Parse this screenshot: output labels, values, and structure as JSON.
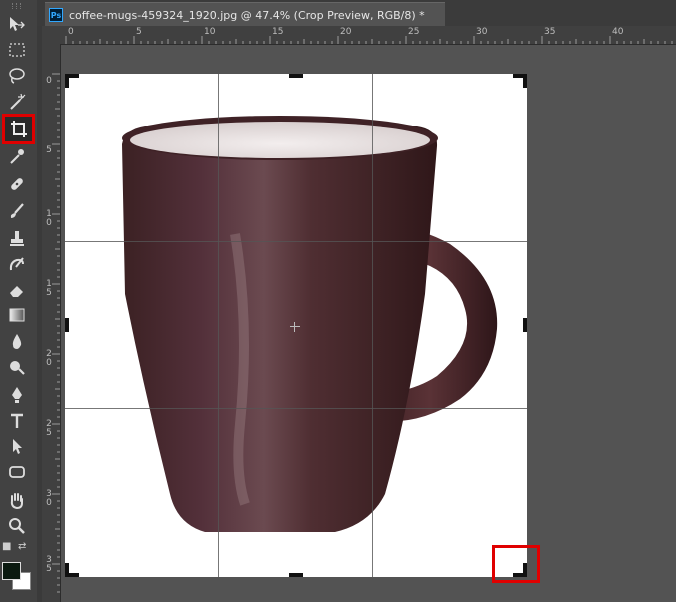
{
  "document_tab": {
    "app_icon": "Ps",
    "title": "coffee-mugs-459324_1920.jpg @ 47.4% (Crop Preview, RGB/8) *"
  },
  "rulers": {
    "top_labels": [
      "0",
      "5",
      "10",
      "15",
      "20",
      "25",
      "30",
      "35",
      "40"
    ],
    "left_labels": [
      "0",
      "5",
      "1 0",
      "1 5",
      "2 0",
      "2 5",
      "3 0",
      "3 5"
    ]
  },
  "tools": [
    {
      "name": "move-tool-icon"
    },
    {
      "name": "rectangular-marquee-tool-icon"
    },
    {
      "name": "lasso-tool-icon"
    },
    {
      "name": "magic-wand-tool-icon"
    },
    {
      "name": "crop-tool-icon",
      "active": true
    },
    {
      "name": "eyedropper-tool-icon"
    },
    {
      "name": "healing-brush-tool-icon"
    },
    {
      "name": "brush-tool-icon"
    },
    {
      "name": "clone-stamp-tool-icon"
    },
    {
      "name": "history-brush-tool-icon"
    },
    {
      "name": "eraser-tool-icon"
    },
    {
      "name": "gradient-tool-icon"
    },
    {
      "name": "blur-tool-icon"
    },
    {
      "name": "dodge-tool-icon"
    },
    {
      "name": "pen-tool-icon"
    },
    {
      "name": "type-tool-icon"
    },
    {
      "name": "path-selection-tool-icon"
    },
    {
      "name": "rectangle-tool-icon"
    },
    {
      "name": "hand-tool-icon"
    },
    {
      "name": "zoom-tool-icon"
    }
  ],
  "colors": {
    "foreground": "#0b1a10",
    "background": "#ffffff",
    "mug_body": "#4a2a2c",
    "highlight": "#e00000"
  }
}
